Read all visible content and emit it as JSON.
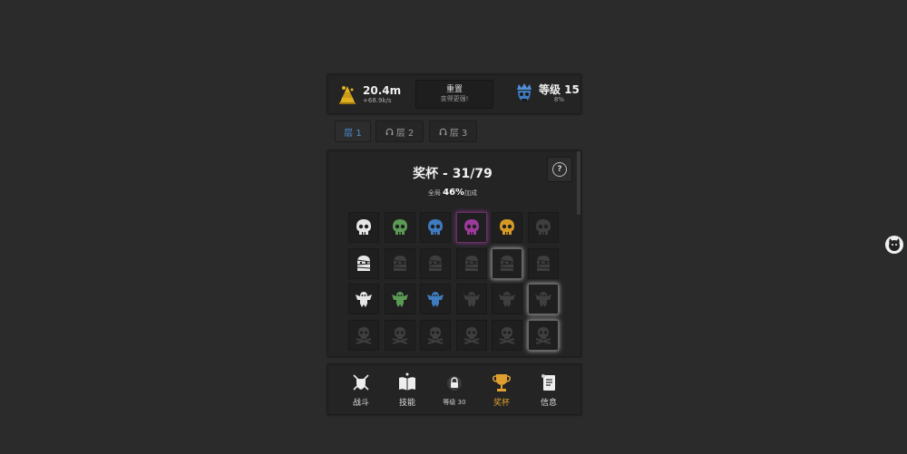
{
  "topbar": {
    "gold": {
      "value": "20.4m",
      "rate": "+68.9k/s",
      "icon": "gold-pile-icon",
      "color": "#e0b020"
    },
    "reset": {
      "label": "重置",
      "sub": "变得更强!"
    },
    "level": {
      "label": "等级 15",
      "progress_text": "8%",
      "icon": "crowned-skull-icon",
      "color": "#4f8fd6"
    }
  },
  "tabs": [
    {
      "label": "层 1",
      "locked": false,
      "active": true
    },
    {
      "label": "层 2",
      "locked": true,
      "active": false
    },
    {
      "label": "层 3",
      "locked": true,
      "active": false
    }
  ],
  "trophies": {
    "title": "奖杯 - 31/79",
    "bonus_prefix": "全局",
    "bonus_value": "46%",
    "bonus_suffix": "加成",
    "help_label": "?",
    "rows": [
      {
        "icon": "skull-icon",
        "cells": [
          "white",
          "green",
          "blue",
          "purple",
          "gold",
          "locked"
        ]
      },
      {
        "icon": "mummy-icon",
        "cells": [
          "white",
          "locked",
          "locked",
          "locked",
          "locked-glow",
          "locked"
        ]
      },
      {
        "icon": "bird-icon",
        "cells": [
          "white",
          "green",
          "blue",
          "locked",
          "locked",
          "locked-glow"
        ]
      },
      {
        "icon": "skull-crossbones-icon",
        "cells": [
          "locked",
          "locked",
          "locked",
          "locked",
          "locked",
          "locked-glow"
        ]
      }
    ]
  },
  "colors": {
    "white": "#e6e6e6",
    "green": "#5a9a55",
    "blue": "#3f7bbf",
    "purple": "#9c3a9c",
    "gold": "#d59a25",
    "locked": "#3e3e3e",
    "accent_active": "#e0a030"
  },
  "nav": [
    {
      "label": "战斗",
      "icon": "crossed-swords-shield-icon",
      "active": false,
      "locked": false
    },
    {
      "label": "技能",
      "icon": "spellbook-icon",
      "active": false,
      "locked": false
    },
    {
      "label": "等级 30",
      "icon": "lock-icon",
      "active": false,
      "locked": true
    },
    {
      "label": "奖杯",
      "icon": "trophy-icon",
      "active": true,
      "locked": false
    },
    {
      "label": "信息",
      "icon": "scroll-icon",
      "active": false,
      "locked": false
    }
  ]
}
